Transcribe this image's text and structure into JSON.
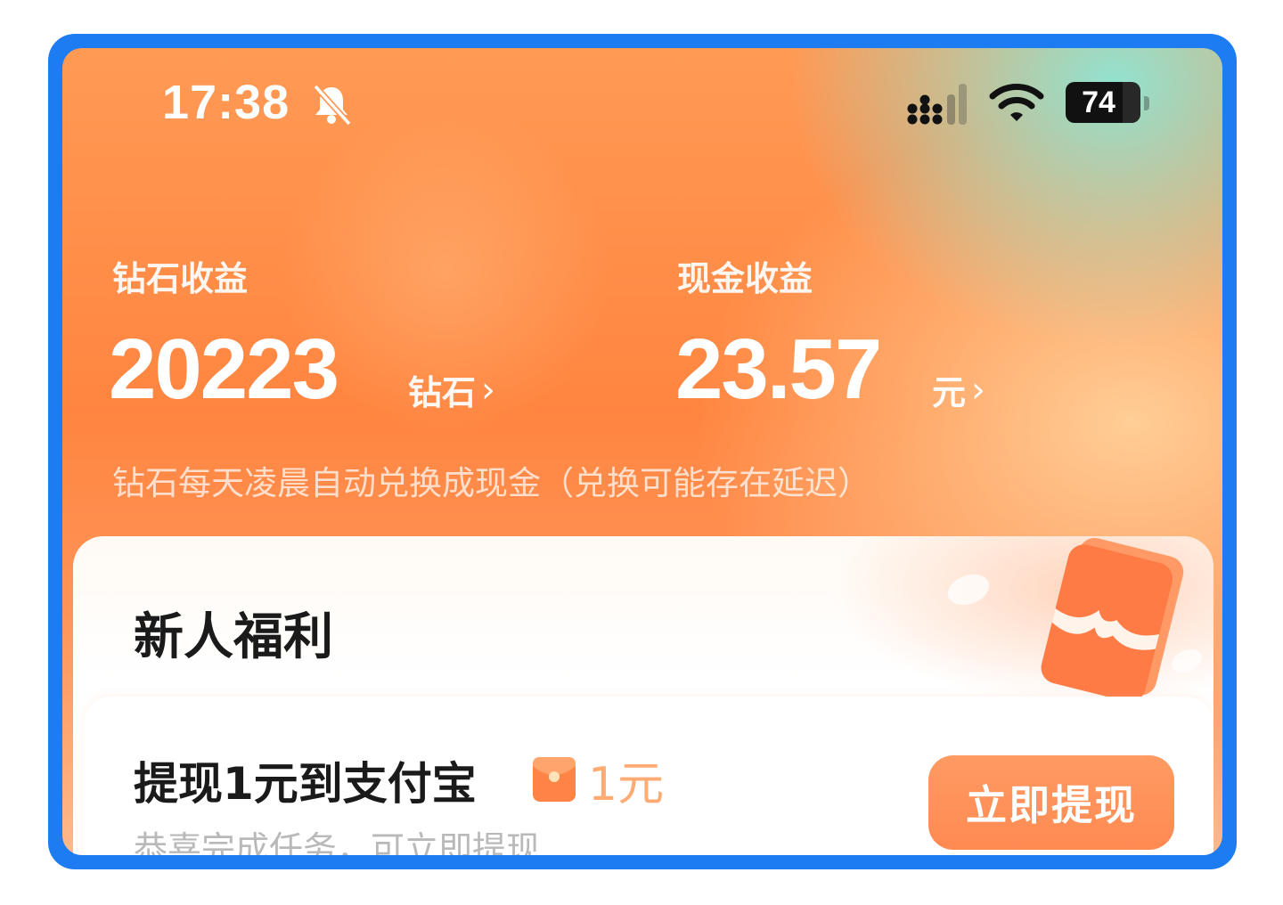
{
  "status_bar": {
    "time": "17:38",
    "battery": "74",
    "icons": [
      "bell-muted-icon",
      "signal-icon",
      "wifi-icon",
      "battery-icon"
    ]
  },
  "earnings": {
    "diamond": {
      "label": "钻石收益",
      "value": "20223",
      "unit": "钻石"
    },
    "cash": {
      "label": "现金收益",
      "value": "23.57",
      "unit": "元"
    },
    "chevron": "›",
    "note": "钻石每天凌晨自动兑换成现金（兑换可能存在延迟）"
  },
  "newcomer": {
    "title": "新人福利",
    "task": {
      "title": "提现1元到支付宝",
      "reward": "1元",
      "subtitle": "恭喜完成任务，可立即提现",
      "button": "立即提现"
    }
  },
  "colors": {
    "frame": "#1e7cf2",
    "accent": "#ff8a52",
    "reward_text": "#ffab73"
  }
}
